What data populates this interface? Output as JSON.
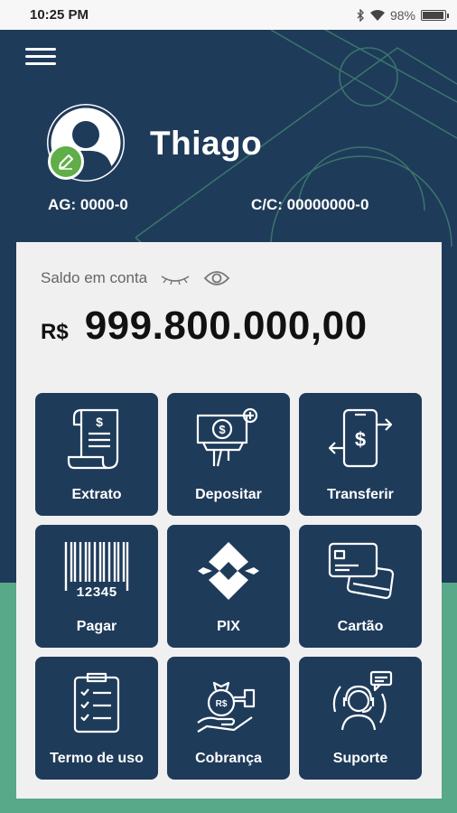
{
  "status_bar": {
    "time": "10:25 PM",
    "battery": "98%",
    "battery_level": 0.98
  },
  "profile": {
    "name": "Thiago",
    "agency": "AG: 0000-0",
    "account": "C/C: 00000000-0"
  },
  "balance": {
    "label": "Saldo em conta",
    "currency": "R$",
    "amount": "999.800.000,00"
  },
  "actions": [
    {
      "label": "Extrato",
      "icon": "receipt-icon"
    },
    {
      "label": "Depositar",
      "icon": "deposit-icon"
    },
    {
      "label": "Transferir",
      "icon": "transfer-icon"
    },
    {
      "label": "Pagar",
      "icon": "barcode-icon"
    },
    {
      "label": "PIX",
      "icon": "pix-icon"
    },
    {
      "label": "Cartão",
      "icon": "card-icon"
    },
    {
      "label": "Termo de uso",
      "icon": "clipboard-icon"
    },
    {
      "label": "Cobrança",
      "icon": "charge-icon"
    },
    {
      "label": "Suporte",
      "icon": "support-icon"
    }
  ],
  "colors": {
    "primary": "#1f3b5a",
    "accent_green": "#58a88a",
    "card_bg": "#f0f0f1",
    "badge_green": "#5fae47"
  }
}
